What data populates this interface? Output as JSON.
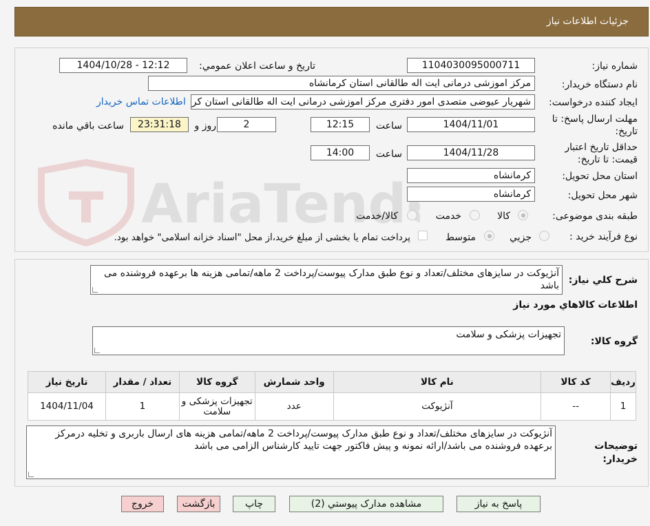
{
  "header": {
    "title": "جزئیات اطلاعات نیاز"
  },
  "form": {
    "need_number_label": "شماره نیاز:",
    "need_number": "1104030095000711",
    "announce_label": "تاریخ و ساعت اعلان عمومي:",
    "announce_value": "1404/10/28 - 12:12",
    "buyer_org_label": "نام دستگاه خريدار:",
    "buyer_org": "مرکز اموزشی درمانی ایت اله طالقانی استان کرمانشاه",
    "requester_label": "ايجاد کننده درخواست:",
    "requester": "شهریار عیوضی متصدی امور دفتری مرکز اموزشی درمانی ایت اله طالقانی استان کرمانشاه",
    "contact_link": "اطلاعات تماس خريدار",
    "reply_deadline_label_1": "مهلت ارسال پاسخ: تا",
    "reply_deadline_label_2": "تاريخ:",
    "reply_date": "1404/11/01",
    "time_label": "ساعت",
    "reply_time": "12:15",
    "days_value": "2",
    "days_label": "روز و",
    "remaining_time": "23:31:18",
    "remaining_label": "ساعت باقي مانده",
    "validity_label_1": "حداقل تاريخ اعتبار",
    "validity_label_2": "قيمت: تا تاريخ:",
    "validity_date": "1404/11/28",
    "validity_time": "14:00",
    "province_label": "استان محل تحويل:",
    "province": "کرمانشاه",
    "city_label": "شهر محل تحويل:",
    "city": "کرمانشاه",
    "category_label": "طبقه بندی موضوعی:",
    "category_options": [
      "کالا",
      "خدمت",
      "کالا/خدمت"
    ],
    "process_label": "نوع فرآیند خرید :",
    "process_options": [
      "جزيي",
      "متوسط"
    ],
    "payment_note": "پرداخت تمام یا بخشی از مبلغ خرید،از محل \"اسناد خزانه اسلامی\" خواهد بود."
  },
  "description": {
    "label": "شرح کلي نياز:",
    "text": "آنژیوکت در سایزهای مختلف/تعداد و نوع طبق مدارک پیوست/پرداخت 2 ماهه/تمامی هزینه ها برعهده فروشنده می باشد"
  },
  "goods_section": {
    "title": "اطلاعات کالاهاي مورد نياز",
    "group_label": "گروه کالا:",
    "group_value": "تجهیزات پزشکی و سلامت"
  },
  "table": {
    "headers": [
      "رديف",
      "کد کالا",
      "نام کالا",
      "واحد شمارش",
      "گروه کالا",
      "تعداد / مقدار",
      "تاريخ نياز"
    ],
    "rows": [
      [
        "1",
        "--",
        "آنژیوکت",
        "عدد",
        "تجهیزات پزشکی و سلامت",
        "1",
        "1404/11/04"
      ]
    ]
  },
  "buyer_notes": {
    "label_1": "توضيحات",
    "label_2": "خريدار:",
    "text": "آنژیوکت در سایزهای مختلف/تعداد و نوع طبق مدارک پیوست/پرداخت 2 ماهه/تمامی هزینه های ارسال باربری و تخلیه درمرکز برعهده فروشنده می باشد/ارائه نمونه و پیش فاکتور جهت تایید کارشناس الزامی می باشد"
  },
  "buttons": {
    "reply": "پاسخ به نياز",
    "attachments": "مشاهده مدارک پيوستي (2)",
    "print": "چاپ",
    "back": "بازگشت",
    "exit": "خروج"
  },
  "colors": {
    "header_bg": "#8a6c3e",
    "link": "#1565c0",
    "green_btn": "#e7f3e4",
    "pink_btn": "#f6cfcf"
  }
}
